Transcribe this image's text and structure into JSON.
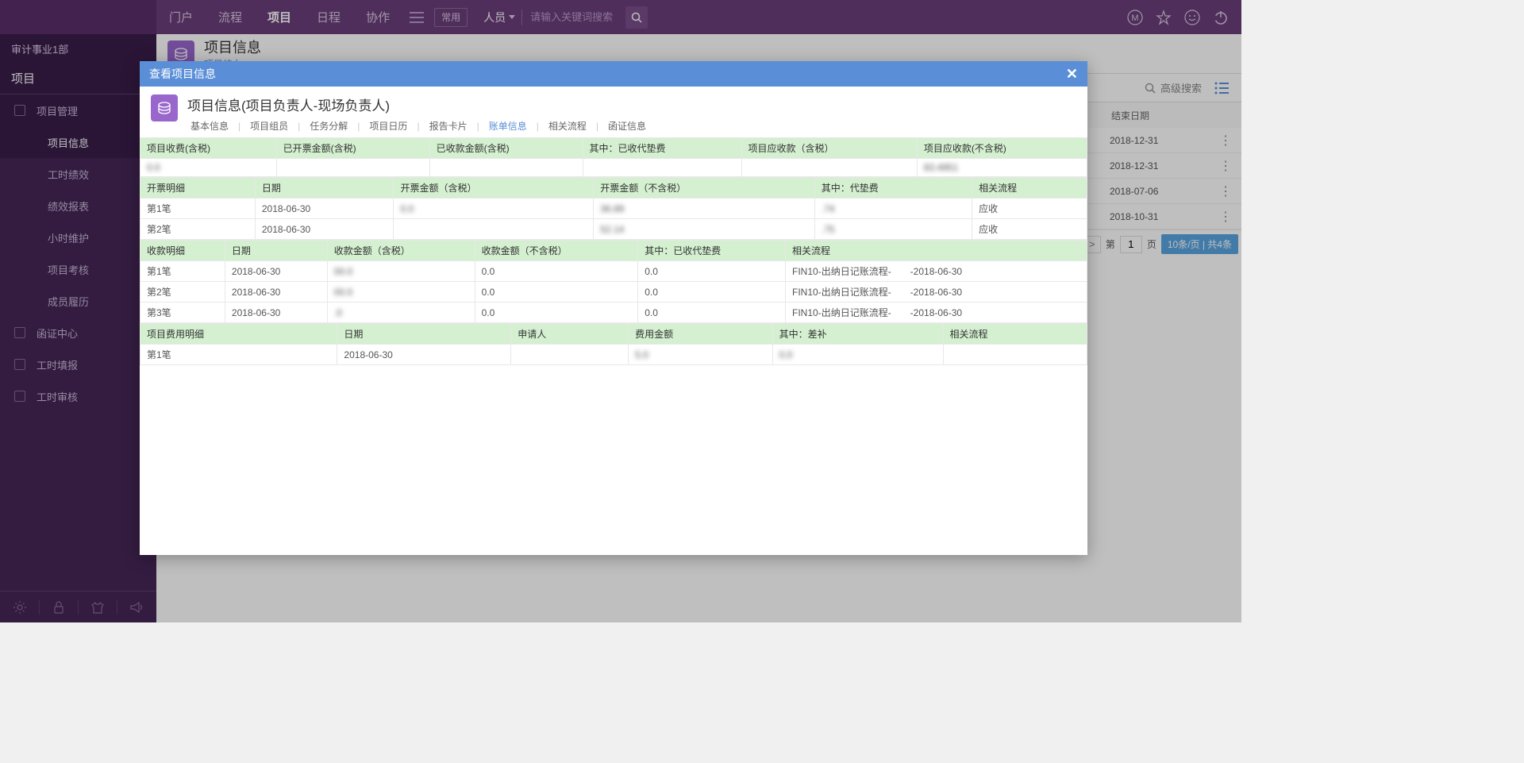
{
  "topNav": {
    "items": [
      "门户",
      "流程",
      "项目",
      "日程",
      "协作"
    ],
    "activeIndex": 2,
    "commonBtn": "常用",
    "searchType": "人员",
    "searchPlaceholder": "请输入关键词搜索"
  },
  "sidebar": {
    "dept": "审计事业1部",
    "sectionTitle": "项目",
    "items": [
      {
        "label": "项目管理",
        "sub": [
          "项目信息",
          "工时绩效",
          "绩效报表",
          "小时维护",
          "项目考核",
          "成员履历"
        ],
        "activeSub": 0
      },
      {
        "label": "函证中心"
      },
      {
        "label": "工时填报"
      },
      {
        "label": "工时审核"
      }
    ]
  },
  "content": {
    "title": "项目信息",
    "subtitle": "项目待办",
    "advSearch": "高级搜索",
    "bgHeadEnd": "结束日期",
    "bgRows": [
      "2018-12-31",
      "2018-12-31",
      "2018-07-06",
      "2018-10-31"
    ],
    "pagination": {
      "prev": "<",
      "next": ">",
      "pagePrefix": "第",
      "pageNum": "1",
      "pageSuffix": "页",
      "info": "10条/页 | 共4条"
    }
  },
  "modal": {
    "title": "查看项目信息",
    "innerTitle": "项目信息(项目负责人-现场负责人)",
    "tabs": [
      "基本信息",
      "项目组员",
      "任务分解",
      "项目日历",
      "报告卡片",
      "账单信息",
      "相关流程",
      "函证信息"
    ],
    "activeTab": 5,
    "billing": {
      "summary": {
        "headers": [
          "项目收费(含税)",
          "已开票金额(含税)",
          "已收款金额(含税)",
          "其中：已收代垫费",
          "项目应收款（含税）",
          "项目应收款(不含税)"
        ],
        "values": [
          "0.0",
          "",
          "",
          "",
          "",
          "83.4951"
        ]
      },
      "invoice": {
        "headers": [
          "开票明细",
          "日期",
          "开票金额（含税）",
          "开票金额（不含税）",
          "其中：代垫费",
          "相关流程"
        ],
        "rows": [
          {
            "no": "第1笔",
            "date": "2018-06-30",
            "amtTax": "0.0",
            "amtNoTax": "36.89",
            "prepay": ".74",
            "flow": "应收"
          },
          {
            "no": "第2笔",
            "date": "2018-06-30",
            "amtTax": "",
            "amtNoTax": "52.14",
            "prepay": ".75",
            "flow": "应收"
          }
        ]
      },
      "receipt": {
        "headers": [
          "收款明细",
          "日期",
          "收款金额（含税）",
          "收款金额（不含税）",
          "其中：已收代垫费",
          "相关流程"
        ],
        "rows": [
          {
            "no": "第1笔",
            "date": "2018-06-30",
            "amtTax": "00.0",
            "amtNoTax": "0.0",
            "prepay": "0.0",
            "flow": "FIN10-出纳日记账流程-　　-2018-06-30"
          },
          {
            "no": "第2笔",
            "date": "2018-06-30",
            "amtTax": "00.0",
            "amtNoTax": "0.0",
            "prepay": "0.0",
            "flow": "FIN10-出纳日记账流程-　　-2018-06-30"
          },
          {
            "no": "第3笔",
            "date": "2018-06-30",
            "amtTax": ".0",
            "amtNoTax": "0.0",
            "prepay": "0.0",
            "flow": "FIN10-出纳日记账流程-　　-2018-06-30"
          }
        ]
      },
      "expense": {
        "headers": [
          "项目费用明细",
          "日期",
          "申请人",
          "费用金额",
          "其中：差补",
          "相关流程"
        ],
        "rows": [
          {
            "no": "第1笔",
            "date": "2018-06-30",
            "applicant": "",
            "amt": "5.0",
            "subsidy": "0.0",
            "flow": ""
          }
        ]
      }
    }
  }
}
